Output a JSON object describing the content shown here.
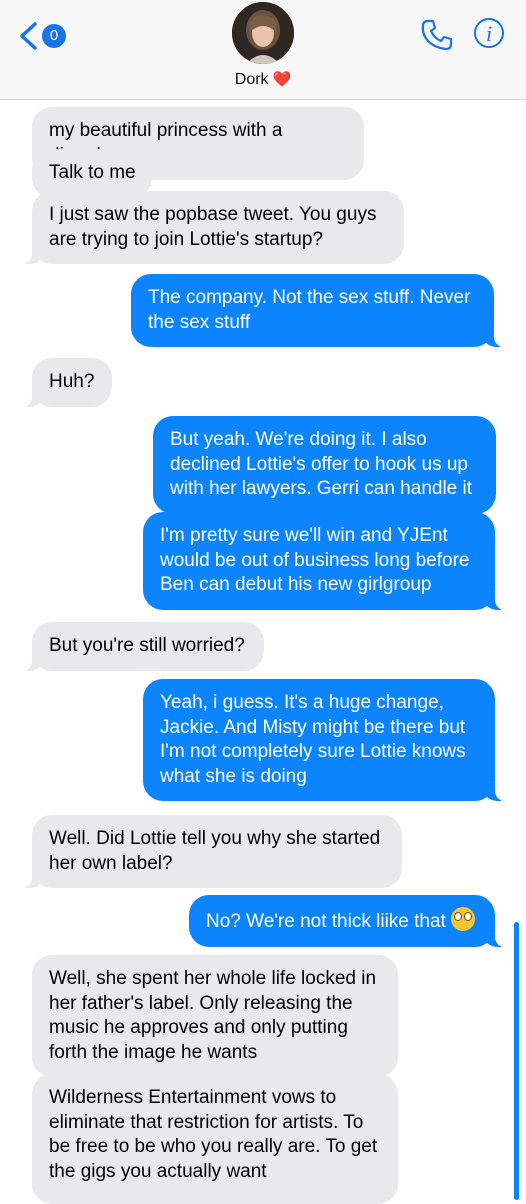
{
  "header": {
    "back_badge": "0",
    "contact_name": "Dork",
    "contact_emoji": "❤️",
    "icons": [
      "chevron-left-icon",
      "phone-icon",
      "info-icon"
    ],
    "accent": "#1a73e8"
  },
  "messages": [
    {
      "dir": "in",
      "text": "my beautiful princess with a disorder"
    },
    {
      "dir": "in",
      "text": "Talk to me"
    },
    {
      "dir": "in",
      "text": "I just saw the popbase tweet. You guys are trying to join Lottie's startup?"
    },
    {
      "dir": "out",
      "text": "The company. Not the sex stuff. Never the sex stuff"
    },
    {
      "dir": "in",
      "text": "Huh?"
    },
    {
      "dir": "out",
      "text": "But yeah. We're doing it. I also declined Lottie's offer to hook us up with her lawyers. Gerri can handle it"
    },
    {
      "dir": "out",
      "text": "I'm pretty sure we'll win and YJEnt would be out of business long before Ben can debut his new girlgroup"
    },
    {
      "dir": "in",
      "text": "But you're still worried?"
    },
    {
      "dir": "out",
      "text": "Yeah, i guess. It's a huge change, Jackie. And Misty might be there but I'm not completely sure Lottie knows what she is doing"
    },
    {
      "dir": "in",
      "text": "Well. Did Lottie tell you why she started her own label?"
    },
    {
      "dir": "out",
      "text": "No? We're not thick liike that",
      "emoji": "face-with-rolling-eyes"
    },
    {
      "dir": "in",
      "text": "Well, she spent her whole life locked in her father's label. Only releasing the music he approves and only putting forth the image he wants"
    },
    {
      "dir": "in",
      "text": "Wilderness Entertainment vows to eliminate that restriction for artists. To be free to be who you really are. To get the gigs you actually want"
    }
  ],
  "colors": {
    "incoming_bubble": "#e9e9eb",
    "outgoing_bubble": "#0b84fe"
  }
}
